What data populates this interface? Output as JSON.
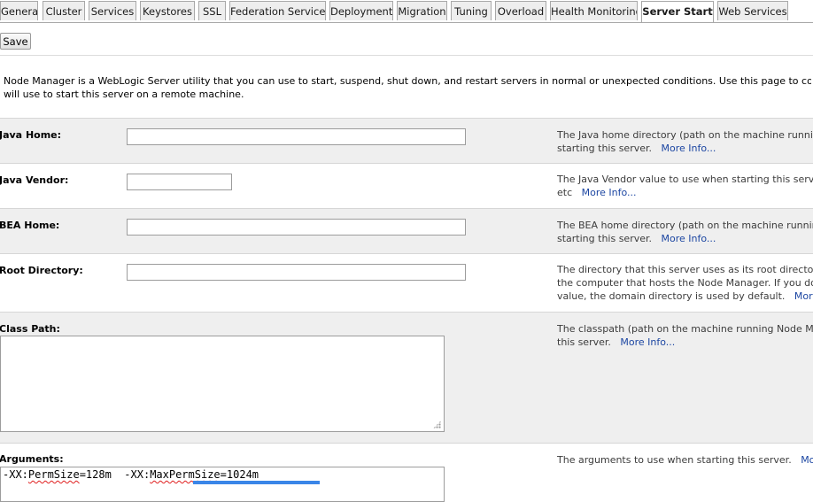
{
  "tabs": [
    {
      "label": "General",
      "active": false
    },
    {
      "label": "Cluster",
      "active": false
    },
    {
      "label": "Services",
      "active": false
    },
    {
      "label": "Keystores",
      "active": false
    },
    {
      "label": "SSL",
      "active": false
    },
    {
      "label": "Federation Services",
      "active": false
    },
    {
      "label": "Deployment",
      "active": false
    },
    {
      "label": "Migration",
      "active": false
    },
    {
      "label": "Tuning",
      "active": false
    },
    {
      "label": "Overload",
      "active": false
    },
    {
      "label": "Health Monitoring",
      "active": false
    },
    {
      "label": "Server Start",
      "active": true
    },
    {
      "label": "Web Services",
      "active": false
    }
  ],
  "toolbar": {
    "save_label": "Save"
  },
  "intro": {
    "line1": "Node Manager is a WebLogic Server utility that you can use to start, suspend, shut down, and restart servers in normal or unexpected conditions. Use this page to configure the startup set",
    "line2": "will use to start this server on a remote machine."
  },
  "more_info": "More Info...",
  "fields": {
    "java_home": {
      "label": "Java Home:",
      "value": "",
      "help1": "The Java home directory (path on the machine running Nod",
      "help2": "starting this server."
    },
    "java_vendor": {
      "label": "Java Vendor:",
      "value": "",
      "help1": "The Java Vendor value to use when starting this server Fo",
      "help2": "etc"
    },
    "bea_home": {
      "label": "BEA Home:",
      "value": "",
      "help1": "The BEA home directory (path on the machine running Nod",
      "help2": "starting this server."
    },
    "root_directory": {
      "label": "Root Directory:",
      "value": "",
      "help1": "The directory that this server uses as its root directory. Th",
      "help2": "the computer that hosts the Node Manager. If you do not s",
      "help3": "value, the domain directory is used by default."
    },
    "class_path": {
      "label": "Class Path:",
      "value": "",
      "help1": "The classpath (path on the machine running Node Manager",
      "help2": "this server."
    },
    "arguments": {
      "label": "Arguments:",
      "value_prefix": "-XX:",
      "value_w1": "PermSize",
      "value_mid": "=128m  -XX:",
      "value_w2": "MaxPermSize",
      "value_suffix": "=1024m",
      "help1": "The arguments to use when starting this server."
    }
  }
}
